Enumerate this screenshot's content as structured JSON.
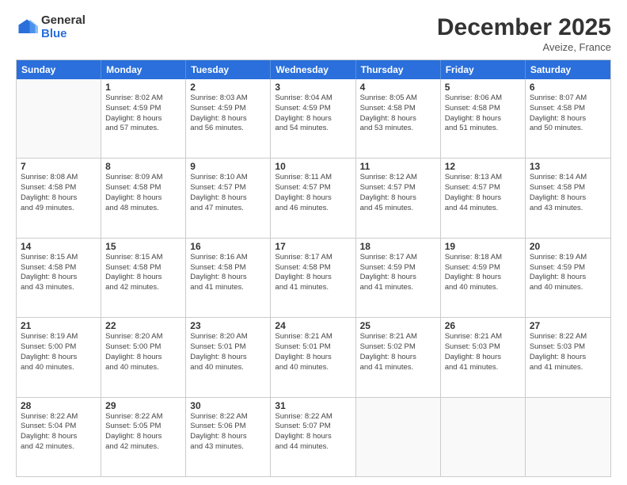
{
  "logo": {
    "general": "General",
    "blue": "Blue"
  },
  "title": {
    "month": "December 2025",
    "location": "Aveize, France"
  },
  "header_days": [
    "Sunday",
    "Monday",
    "Tuesday",
    "Wednesday",
    "Thursday",
    "Friday",
    "Saturday"
  ],
  "weeks": [
    [
      {
        "day": "",
        "info": ""
      },
      {
        "day": "1",
        "info": "Sunrise: 8:02 AM\nSunset: 4:59 PM\nDaylight: 8 hours\nand 57 minutes."
      },
      {
        "day": "2",
        "info": "Sunrise: 8:03 AM\nSunset: 4:59 PM\nDaylight: 8 hours\nand 56 minutes."
      },
      {
        "day": "3",
        "info": "Sunrise: 8:04 AM\nSunset: 4:59 PM\nDaylight: 8 hours\nand 54 minutes."
      },
      {
        "day": "4",
        "info": "Sunrise: 8:05 AM\nSunset: 4:58 PM\nDaylight: 8 hours\nand 53 minutes."
      },
      {
        "day": "5",
        "info": "Sunrise: 8:06 AM\nSunset: 4:58 PM\nDaylight: 8 hours\nand 51 minutes."
      },
      {
        "day": "6",
        "info": "Sunrise: 8:07 AM\nSunset: 4:58 PM\nDaylight: 8 hours\nand 50 minutes."
      }
    ],
    [
      {
        "day": "7",
        "info": "Sunrise: 8:08 AM\nSunset: 4:58 PM\nDaylight: 8 hours\nand 49 minutes."
      },
      {
        "day": "8",
        "info": "Sunrise: 8:09 AM\nSunset: 4:58 PM\nDaylight: 8 hours\nand 48 minutes."
      },
      {
        "day": "9",
        "info": "Sunrise: 8:10 AM\nSunset: 4:57 PM\nDaylight: 8 hours\nand 47 minutes."
      },
      {
        "day": "10",
        "info": "Sunrise: 8:11 AM\nSunset: 4:57 PM\nDaylight: 8 hours\nand 46 minutes."
      },
      {
        "day": "11",
        "info": "Sunrise: 8:12 AM\nSunset: 4:57 PM\nDaylight: 8 hours\nand 45 minutes."
      },
      {
        "day": "12",
        "info": "Sunrise: 8:13 AM\nSunset: 4:57 PM\nDaylight: 8 hours\nand 44 minutes."
      },
      {
        "day": "13",
        "info": "Sunrise: 8:14 AM\nSunset: 4:58 PM\nDaylight: 8 hours\nand 43 minutes."
      }
    ],
    [
      {
        "day": "14",
        "info": "Sunrise: 8:15 AM\nSunset: 4:58 PM\nDaylight: 8 hours\nand 43 minutes."
      },
      {
        "day": "15",
        "info": "Sunrise: 8:15 AM\nSunset: 4:58 PM\nDaylight: 8 hours\nand 42 minutes."
      },
      {
        "day": "16",
        "info": "Sunrise: 8:16 AM\nSunset: 4:58 PM\nDaylight: 8 hours\nand 41 minutes."
      },
      {
        "day": "17",
        "info": "Sunrise: 8:17 AM\nSunset: 4:58 PM\nDaylight: 8 hours\nand 41 minutes."
      },
      {
        "day": "18",
        "info": "Sunrise: 8:17 AM\nSunset: 4:59 PM\nDaylight: 8 hours\nand 41 minutes."
      },
      {
        "day": "19",
        "info": "Sunrise: 8:18 AM\nSunset: 4:59 PM\nDaylight: 8 hours\nand 40 minutes."
      },
      {
        "day": "20",
        "info": "Sunrise: 8:19 AM\nSunset: 4:59 PM\nDaylight: 8 hours\nand 40 minutes."
      }
    ],
    [
      {
        "day": "21",
        "info": "Sunrise: 8:19 AM\nSunset: 5:00 PM\nDaylight: 8 hours\nand 40 minutes."
      },
      {
        "day": "22",
        "info": "Sunrise: 8:20 AM\nSunset: 5:00 PM\nDaylight: 8 hours\nand 40 minutes."
      },
      {
        "day": "23",
        "info": "Sunrise: 8:20 AM\nSunset: 5:01 PM\nDaylight: 8 hours\nand 40 minutes."
      },
      {
        "day": "24",
        "info": "Sunrise: 8:21 AM\nSunset: 5:01 PM\nDaylight: 8 hours\nand 40 minutes."
      },
      {
        "day": "25",
        "info": "Sunrise: 8:21 AM\nSunset: 5:02 PM\nDaylight: 8 hours\nand 41 minutes."
      },
      {
        "day": "26",
        "info": "Sunrise: 8:21 AM\nSunset: 5:03 PM\nDaylight: 8 hours\nand 41 minutes."
      },
      {
        "day": "27",
        "info": "Sunrise: 8:22 AM\nSunset: 5:03 PM\nDaylight: 8 hours\nand 41 minutes."
      }
    ],
    [
      {
        "day": "28",
        "info": "Sunrise: 8:22 AM\nSunset: 5:04 PM\nDaylight: 8 hours\nand 42 minutes."
      },
      {
        "day": "29",
        "info": "Sunrise: 8:22 AM\nSunset: 5:05 PM\nDaylight: 8 hours\nand 42 minutes."
      },
      {
        "day": "30",
        "info": "Sunrise: 8:22 AM\nSunset: 5:06 PM\nDaylight: 8 hours\nand 43 minutes."
      },
      {
        "day": "31",
        "info": "Sunrise: 8:22 AM\nSunset: 5:07 PM\nDaylight: 8 hours\nand 44 minutes."
      },
      {
        "day": "",
        "info": ""
      },
      {
        "day": "",
        "info": ""
      },
      {
        "day": "",
        "info": ""
      }
    ]
  ]
}
